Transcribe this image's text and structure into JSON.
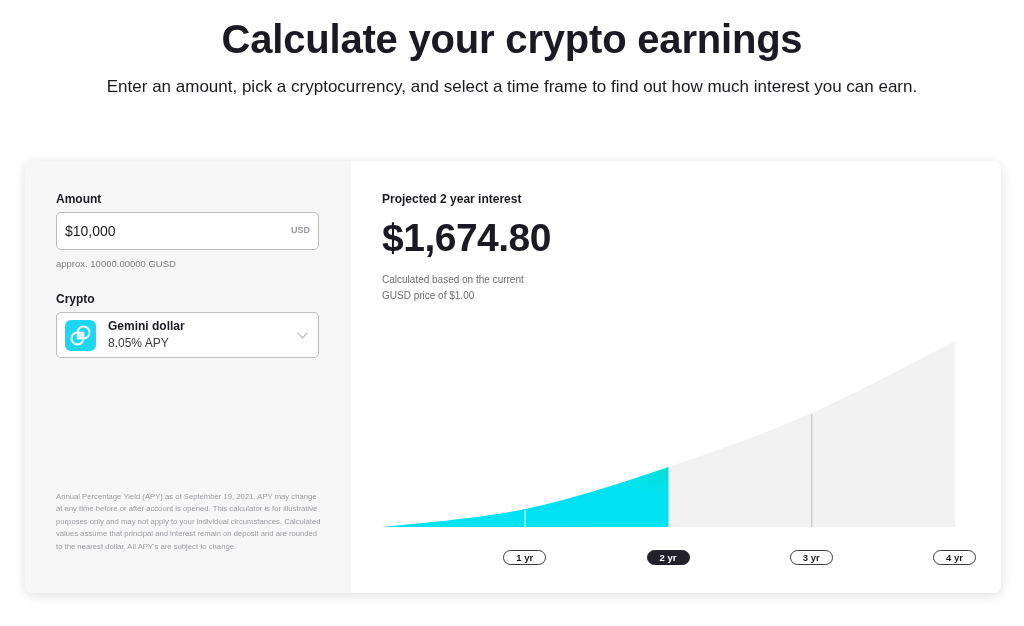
{
  "heading": {
    "title": "Calculate your crypto earnings",
    "subtitle": "Enter an amount, pick a cryptocurrency, and select a time frame to find out how much interest you can earn."
  },
  "calculator": {
    "amount": {
      "label": "Amount",
      "value": "$10,000",
      "unit": "USD",
      "hint": "approx. 10000.00000 GUSD"
    },
    "crypto": {
      "label": "Crypto",
      "name": "Gemini dollar",
      "apy": "8.05% APY"
    },
    "disclaimer": "Annual Percentage Yield (APY) as of September 19, 2021. APY may change at any time before or after account is opened. This calculator is for illustrative purposes only and may not apply to your individual circumstances. Calculated values assume that principal and interest remain on deposit and are rounded to the nearest dollar. All APY's are subject to change.",
    "result": {
      "label": "Projected 2 year interest",
      "amount": "$1,674.80",
      "note": "Calculated based on the current GUSD price of $1.00"
    },
    "timeframes": [
      {
        "label": "1 yr",
        "selected": false
      },
      {
        "label": "2 yr",
        "selected": true
      },
      {
        "label": "3 yr",
        "selected": false
      },
      {
        "label": "4 yr",
        "selected": false
      }
    ]
  }
}
